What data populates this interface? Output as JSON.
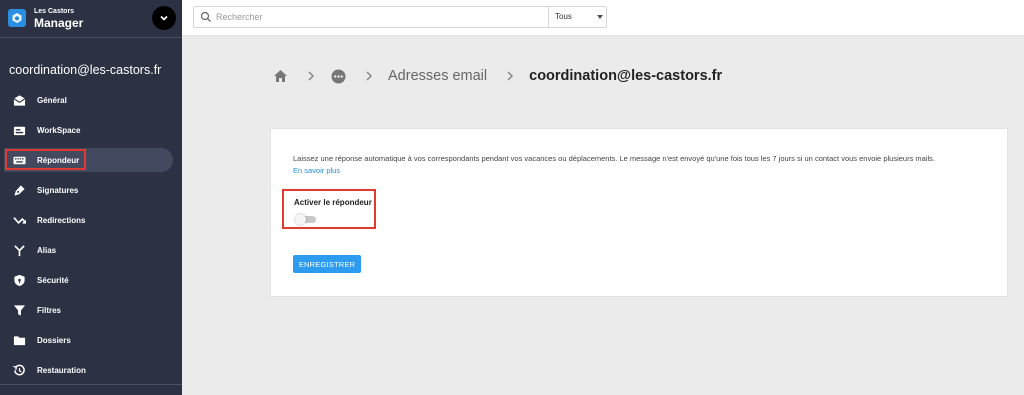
{
  "brand": {
    "sub": "Les Castors",
    "main": "Manager"
  },
  "account": "coordination@les-castors.fr",
  "sidebar": {
    "items": [
      {
        "label": "Général",
        "icon": "envelope-open-icon"
      },
      {
        "label": "WorkSpace",
        "icon": "workspace-icon"
      },
      {
        "label": "Répondeur",
        "icon": "keyboard-icon",
        "active": true
      },
      {
        "label": "Signatures",
        "icon": "pen-nib-icon"
      },
      {
        "label": "Redirections",
        "icon": "redirect-arrow-icon"
      },
      {
        "label": "Alias",
        "icon": "fork-icon"
      },
      {
        "label": "Sécurité",
        "icon": "shield-icon"
      },
      {
        "label": "Filtres",
        "icon": "filter-icon"
      },
      {
        "label": "Dossiers",
        "icon": "folder-icon"
      },
      {
        "label": "Restauration",
        "icon": "history-icon"
      }
    ]
  },
  "search": {
    "placeholder": "Rechercher",
    "scope": "Tous"
  },
  "breadcrumb": {
    "section": "Adresses email",
    "current": "coordination@les-castors.fr"
  },
  "responder": {
    "description": "Laissez une réponse automatique à vos correspondants pendant vos vacances ou déplacements. Le message n'est envoyé qu'une fois tous les 7 jours si un contact vous envoie plusieurs mails.",
    "learn_more": "En savoir plus",
    "toggle_label": "Activer le répondeur",
    "enabled": false,
    "save_label": "ENREGISTRER"
  },
  "colors": {
    "sidebar": "#2c3244",
    "accent": "#2d9cf0",
    "highlight": "#e03b30"
  }
}
